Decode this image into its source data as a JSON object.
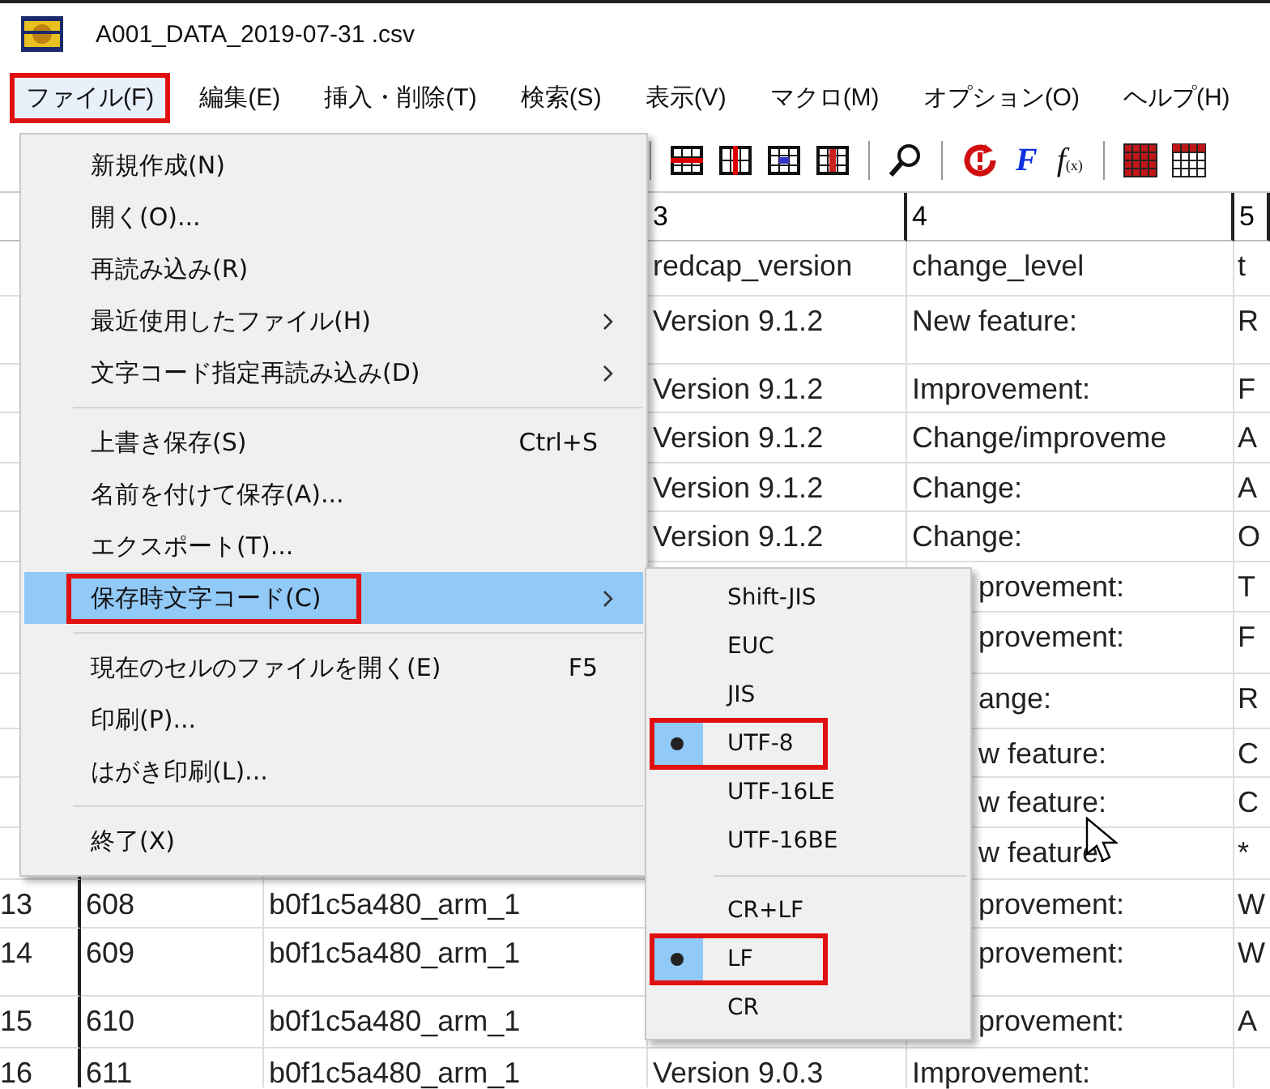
{
  "window": {
    "title": "A001_DATA_2019-07-31 .csv"
  },
  "menu_bar": [
    {
      "label": "ファイル(F)",
      "selected": true,
      "annotated": true
    },
    {
      "label": "編集(E)",
      "selected": false,
      "annotated": false
    },
    {
      "label": "挿入・削除(T)",
      "selected": false,
      "annotated": false
    },
    {
      "label": "検索(S)",
      "selected": false,
      "annotated": false
    },
    {
      "label": "表示(V)",
      "selected": false,
      "annotated": false
    },
    {
      "label": "マクロ(M)",
      "selected": false,
      "annotated": false
    },
    {
      "label": "オプション(O)",
      "selected": false,
      "annotated": false
    },
    {
      "label": "ヘルプ(H)",
      "selected": false,
      "annotated": false
    }
  ],
  "toolbar": {
    "font_glyph": "F",
    "function_glyph": "f",
    "function_sub": "(x)"
  },
  "file_menu": [
    {
      "kind": "item",
      "label": "新規作成(N)",
      "submenu": false,
      "selected": false,
      "annotated": false
    },
    {
      "kind": "item",
      "label": "開く(O)...",
      "submenu": false,
      "selected": false,
      "annotated": false
    },
    {
      "kind": "item",
      "label": "再読み込み(R)",
      "submenu": false,
      "selected": false,
      "annotated": false
    },
    {
      "kind": "item",
      "label": "最近使用したファイル(H)",
      "submenu": true,
      "selected": false,
      "annotated": false
    },
    {
      "kind": "item",
      "label": "文字コード指定再読み込み(D)",
      "submenu": true,
      "selected": false,
      "annotated": false
    },
    {
      "kind": "separator"
    },
    {
      "kind": "item",
      "label": "上書き保存(S)",
      "shortcut": "Ctrl+S",
      "submenu": false,
      "selected": false,
      "annotated": false
    },
    {
      "kind": "item",
      "label": "名前を付けて保存(A)...",
      "submenu": false,
      "selected": false,
      "annotated": false
    },
    {
      "kind": "item",
      "label": "エクスポート(T)...",
      "submenu": false,
      "selected": false,
      "annotated": false
    },
    {
      "kind": "item",
      "label": "保存時文字コード(C)",
      "submenu": true,
      "selected": true,
      "annotated": true
    },
    {
      "kind": "separator"
    },
    {
      "kind": "item",
      "label": "現在のセルのファイルを開く(E)",
      "shortcut": "F5",
      "submenu": false,
      "selected": false,
      "annotated": false
    },
    {
      "kind": "item",
      "label": "印刷(P)...",
      "submenu": false,
      "selected": false,
      "annotated": false
    },
    {
      "kind": "item",
      "label": "はがき印刷(L)...",
      "submenu": false,
      "selected": false,
      "annotated": false
    },
    {
      "kind": "separator"
    },
    {
      "kind": "item",
      "label": "終了(X)",
      "submenu": false,
      "selected": false,
      "annotated": false
    }
  ],
  "encoding_submenu": [
    {
      "kind": "item",
      "label": "Shift-JIS",
      "checked": false,
      "annotated": false
    },
    {
      "kind": "item",
      "label": "EUC",
      "checked": false,
      "annotated": false
    },
    {
      "kind": "item",
      "label": "JIS",
      "checked": false,
      "annotated": false
    },
    {
      "kind": "item",
      "label": "UTF-8",
      "checked": true,
      "annotated": true
    },
    {
      "kind": "item",
      "label": "UTF-16LE",
      "checked": false,
      "annotated": false
    },
    {
      "kind": "item",
      "label": "UTF-16BE",
      "checked": false,
      "annotated": false
    },
    {
      "kind": "separator"
    },
    {
      "kind": "item",
      "label": "CR+LF",
      "checked": false,
      "annotated": false
    },
    {
      "kind": "item",
      "label": "LF",
      "checked": true,
      "annotated": true
    },
    {
      "kind": "item",
      "label": "CR",
      "checked": false,
      "annotated": false
    }
  ],
  "table": {
    "columns": [
      "3",
      "4",
      "5"
    ],
    "rows": [
      {
        "col_3": "redcap_version",
        "col_4": "change_level",
        "col_5": "t"
      },
      {
        "col_3": "Version 9.1.2",
        "col_4": "New feature:",
        "col_5": "R"
      },
      {
        "col_3": "Version 9.1.2",
        "col_4": "Improvement:",
        "col_5": "F"
      },
      {
        "col_3": "Version 9.1.2",
        "col_4": "Change/improveme",
        "col_5": "A"
      },
      {
        "col_3": "Version 9.1.2",
        "col_4": "Change:",
        "col_5": "A"
      },
      {
        "col_3": "Version 9.1.2",
        "col_4": "Change:",
        "col_5": "O"
      },
      {
        "col_4": "provement:",
        "col_5": "T"
      },
      {
        "col_4": "provement:",
        "col_5": "F"
      },
      {
        "col_4": "ange:",
        "col_5": "R"
      },
      {
        "col_4": "w feature:",
        "col_5": "C"
      },
      {
        "col_4": "w feature:",
        "col_5": "C"
      },
      {
        "col_4": "w feature:",
        "col_5": "*"
      },
      {
        "row_number": "13",
        "col_1": "608",
        "col_2": "b0f1c5a480_arm_1",
        "col_4": "provement:",
        "col_5": "W"
      },
      {
        "row_number": "14",
        "col_1": "609",
        "col_2": "b0f1c5a480_arm_1",
        "col_4": "provement:",
        "col_5": "W"
      },
      {
        "row_number": "15",
        "col_1": "610",
        "col_2": "b0f1c5a480_arm_1",
        "col_4": "provement:",
        "col_5": "A"
      },
      {
        "row_number": "16",
        "col_1": "611",
        "col_2": "b0f1c5a480_arm_1",
        "col_3": "Version 9.0.3",
        "col_4": "Improvement:"
      }
    ]
  }
}
